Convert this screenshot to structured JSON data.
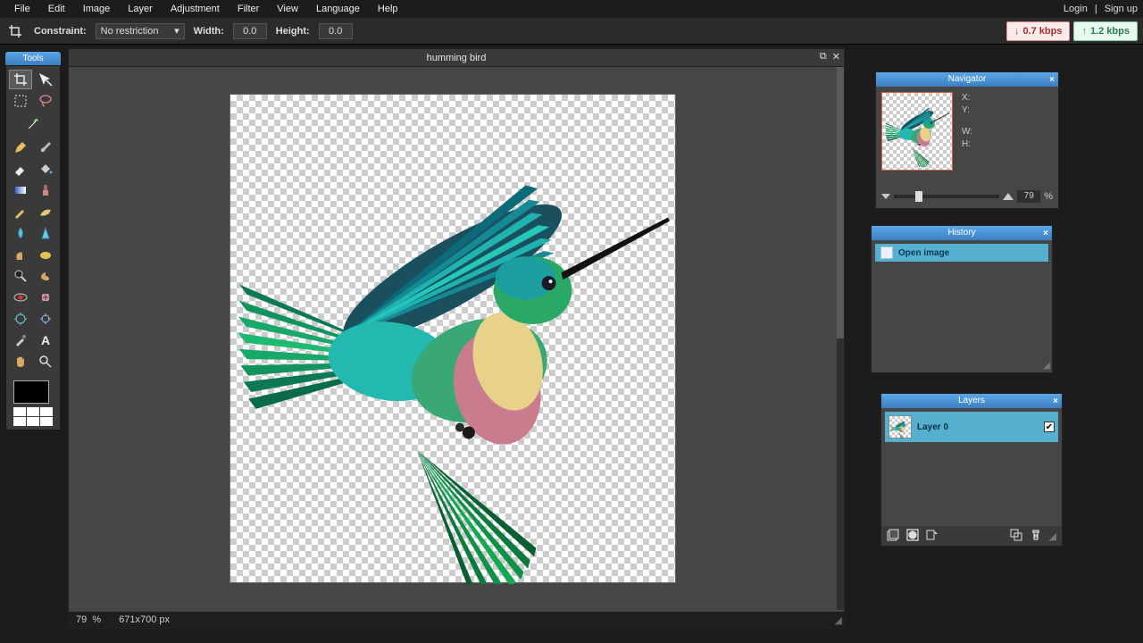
{
  "menu": [
    "File",
    "Edit",
    "Image",
    "Layer",
    "Adjustment",
    "Filter",
    "View",
    "Language",
    "Help"
  ],
  "auth": {
    "login": "Login",
    "divider": "|",
    "signup": "Sign up"
  },
  "options": {
    "constraint_label": "Constraint:",
    "constraint_value": "No restriction",
    "width_label": "Width:",
    "width_value": "0.0",
    "height_label": "Height:",
    "height_value": "0.0"
  },
  "net": {
    "down": "0.7 kbps",
    "up": "1.2 kbps"
  },
  "tools_title": "Tools",
  "doc": {
    "title": "humming bird",
    "zoom": "79",
    "zoom_unit": "%",
    "dims": "671x700 px"
  },
  "navigator": {
    "title": "Navigator",
    "x_label": "X:",
    "y_label": "Y:",
    "w_label": "W:",
    "h_label": "H:",
    "zoom": "79",
    "zoom_unit": "%"
  },
  "history": {
    "title": "History",
    "items": [
      "Open image"
    ]
  },
  "layers": {
    "title": "Layers",
    "items": [
      {
        "name": "Layer 0",
        "visible": true
      }
    ]
  }
}
